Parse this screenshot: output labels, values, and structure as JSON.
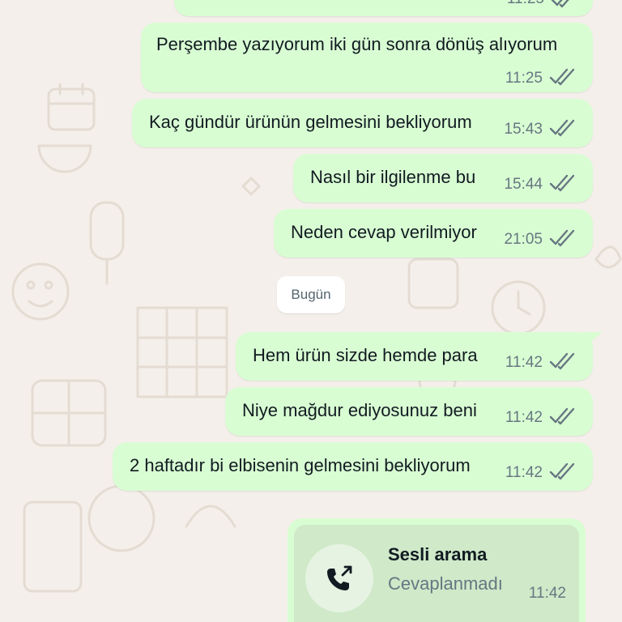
{
  "messages": [
    {
      "text": "",
      "time": "11:25",
      "status": "read"
    },
    {
      "text": "Perşembe yazıyorum iki gün sonra dönüş alıyorum",
      "time": "11:25",
      "status": "read"
    },
    {
      "text": "Kaç gündür ürünün gelmesini bekliyorum",
      "time": "15:43",
      "status": "read"
    },
    {
      "text": "Nasıl  bir ilgilenme bu",
      "time": "15:44",
      "status": "read"
    },
    {
      "text": "Neden cevap verilmiyor",
      "time": "21:05",
      "status": "read"
    },
    {
      "text": "Hem ürün sizde hemde para",
      "time": "11:42",
      "status": "read"
    },
    {
      "text": "Niye mağdur ediyosunuz beni",
      "time": "11:42",
      "status": "read"
    },
    {
      "text": "2 haftadır bi elbisenin gelmesini bekliyorum",
      "time": "11:42",
      "status": "read"
    }
  ],
  "date_separator": "Bugün",
  "call": {
    "title": "Sesli arama",
    "subtitle": "Cevaplanmadı",
    "time": "11:42",
    "icon": "outgoing-call-icon"
  },
  "colors": {
    "wallpaper": "#f4efea",
    "doodle": "#e4dcd3",
    "outgoing_bubble": "#d9fdd3",
    "read_ticks": "#667781",
    "text": "#111b21",
    "meta": "#667781"
  }
}
